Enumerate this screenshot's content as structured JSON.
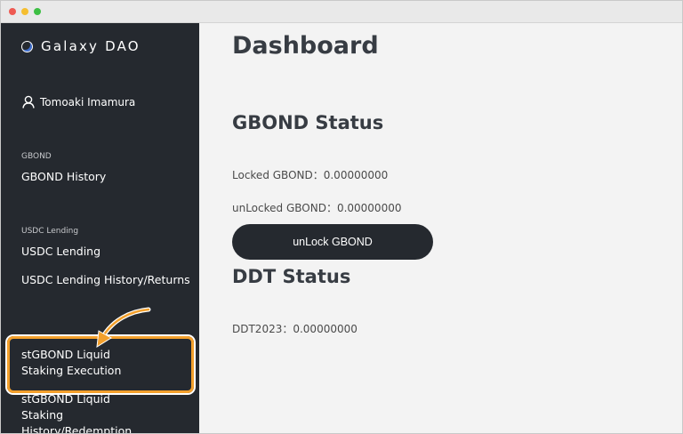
{
  "app": {
    "brand": "Galaxy DAO",
    "user_name": "Tomoaki Imamura"
  },
  "window": {
    "controls": [
      "close",
      "minimize",
      "maximize"
    ]
  },
  "sidebar": {
    "sections": [
      {
        "label": "GBOND",
        "items": [
          "GBOND History"
        ]
      },
      {
        "label": "USDC Lending",
        "items": [
          "USDC Lending",
          "USDC Lending History/Returns"
        ]
      },
      {
        "label": "",
        "items": [
          "stGBOND Liquid Staking Execution",
          "stGBOND Liquid Staking History/Redemption"
        ]
      }
    ],
    "highlighted_item": "stGBOND Liquid Staking Execution"
  },
  "main": {
    "title": "Dashboard",
    "gbond": {
      "title": "GBOND Status",
      "locked": "Locked GBOND：0.00000000",
      "unlocked": "unLocked GBOND：0.00000000",
      "unlock_button": "unLock GBOND"
    },
    "ddt": {
      "title": "DDT Status",
      "ddt2023": "DDT2023：0.00000000"
    }
  },
  "colors": {
    "sidebar_bg": "#25292f",
    "main_bg": "#f3f3f3",
    "highlight": "#f3a02c",
    "button_bg": "#25292f"
  },
  "icons": {
    "logo": "galaxy-logo-icon",
    "user": "user-icon",
    "arrow": "curved-arrow-icon"
  }
}
